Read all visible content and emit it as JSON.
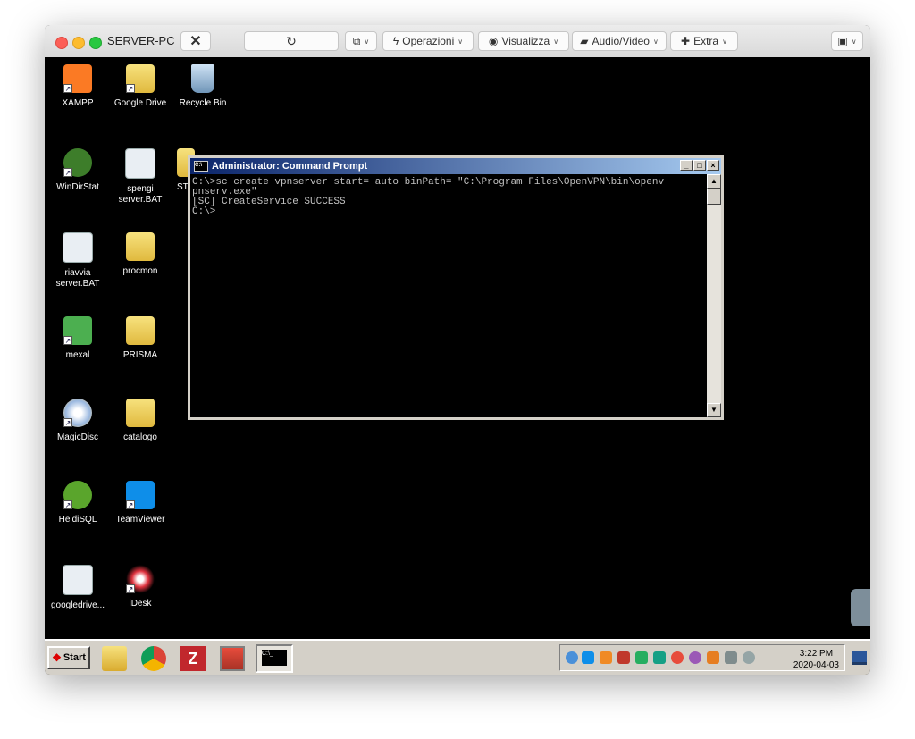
{
  "window": {
    "title": "SERVER-PC",
    "toolbar": {
      "operations": "Operazioni",
      "view": "Visualizza",
      "audio_video": "Audio/Video",
      "extra": "Extra"
    }
  },
  "desktop": {
    "icons": [
      {
        "label": "XAMPP"
      },
      {
        "label": "Google Drive"
      },
      {
        "label": "Recycle Bin"
      },
      {
        "label": "WinDirStat"
      },
      {
        "label": "spengi server.BAT"
      },
      {
        "label": "riavvia server.BAT"
      },
      {
        "label": "procmon"
      },
      {
        "label": "mexal"
      },
      {
        "label": "PRISMA"
      },
      {
        "label": "MagicDisc"
      },
      {
        "label": "catalogo"
      },
      {
        "label": "HeidiSQL"
      },
      {
        "label": "TeamViewer"
      },
      {
        "label": "googledrive..."
      },
      {
        "label": "iDesk"
      }
    ],
    "partial_label": "ST"
  },
  "cmd": {
    "title": "Administrator: Command Prompt",
    "lines": [
      "C:\\>sc create vpnserver start= auto binPath= \"C:\\Program Files\\OpenVPN\\bin\\openv",
      "pnserv.exe\"",
      "[SC] CreateService SUCCESS",
      "",
      "C:\\>"
    ]
  },
  "taskbar": {
    "start_label": "Start",
    "clock_time": "3:22 PM",
    "clock_date": "2020-04-03"
  },
  "colors": {
    "desktop_bg": "#000000",
    "taskbar_bg": "#d4d0c8",
    "cmd_title_start": "#0a246a"
  }
}
